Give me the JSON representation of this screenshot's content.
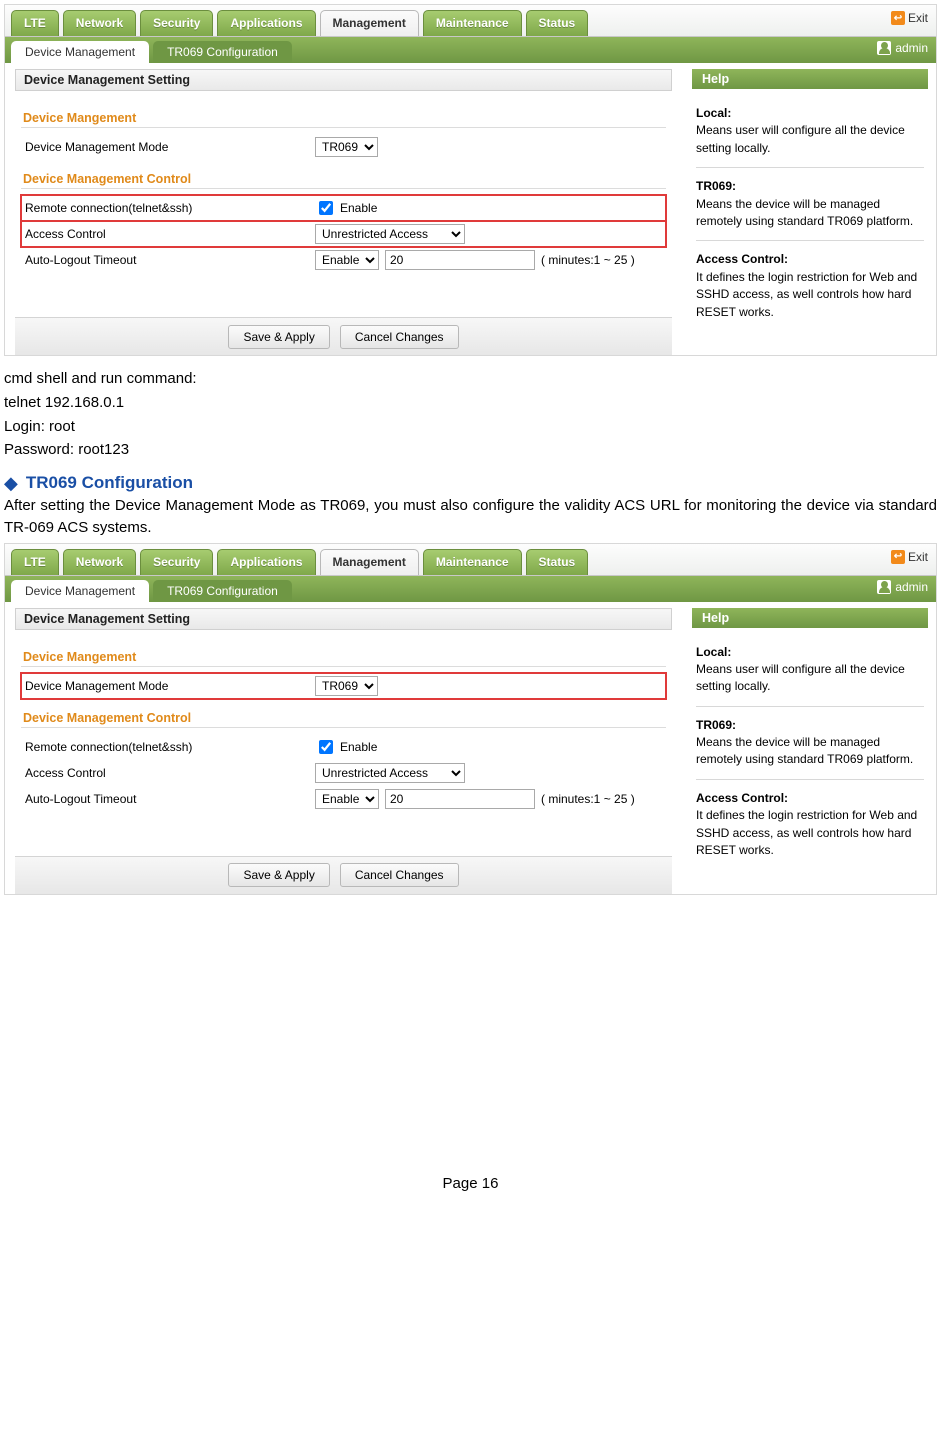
{
  "nav": {
    "primary": [
      "LTE",
      "Network",
      "Security",
      "Applications",
      "Management",
      "Maintenance",
      "Status"
    ],
    "active_primary_index": 4,
    "secondary": [
      "Device Management",
      "TR069 Configuration"
    ],
    "exit_label": "Exit",
    "admin_label": "admin"
  },
  "panel1": {
    "active_secondary_index": 0,
    "title": "Device Management  Setting",
    "section1": "Device Mangement",
    "mode_label": "Device Management Mode",
    "mode_value": "TR069",
    "section2": "Device Management Control",
    "remote_label": "Remote connection(telnet&ssh)",
    "remote_enable_label": "Enable",
    "access_label": "Access Control",
    "access_value": "Unrestricted Access",
    "auto_label": "Auto-Logout Timeout",
    "auto_enable_value": "Enable",
    "auto_minutes_value": "20",
    "auto_hint": "( minutes:1 ~ 25 )",
    "highlight_rows": [
      "remote",
      "access"
    ],
    "save_label": "Save & Apply",
    "cancel_label": "Cancel Changes"
  },
  "panel2": {
    "active_secondary_index": 0,
    "title": "Device Management  Setting",
    "section1": "Device Mangement",
    "mode_label": "Device Management Mode",
    "mode_value": "TR069",
    "section2": "Device Management Control",
    "remote_label": "Remote connection(telnet&ssh)",
    "remote_enable_label": "Enable",
    "access_label": "Access Control",
    "access_value": "Unrestricted Access",
    "auto_label": "Auto-Logout Timeout",
    "auto_enable_value": "Enable",
    "auto_minutes_value": "20",
    "auto_hint": "( minutes:1 ~ 25 )",
    "highlight_rows": [
      "mode"
    ],
    "save_label": "Save & Apply",
    "cancel_label": "Cancel Changes"
  },
  "help": {
    "title": "Help",
    "local_h": "Local:",
    "local_t": "Means user will configure all the device setting locally.",
    "tr_h": "TR069:",
    "tr_t": "Means the device will be managed remotely using standard TR069 platform.",
    "ac_h": "Access Control:",
    "ac_t": "It defines the login restriction for Web and SSHD access, as well controls how hard RESET works."
  },
  "article": {
    "line1": "cmd shell and run command:",
    "line2": "telnet 192.168.0.1",
    "line3": "Login: root",
    "line4": "Password: root123",
    "head": "TR069 Configuration",
    "para": "After setting the Device Management Mode as TR069, you must also configure the validity ACS URL for monitoring the device via standard TR-069 ACS systems.",
    "page": "Page 16"
  }
}
